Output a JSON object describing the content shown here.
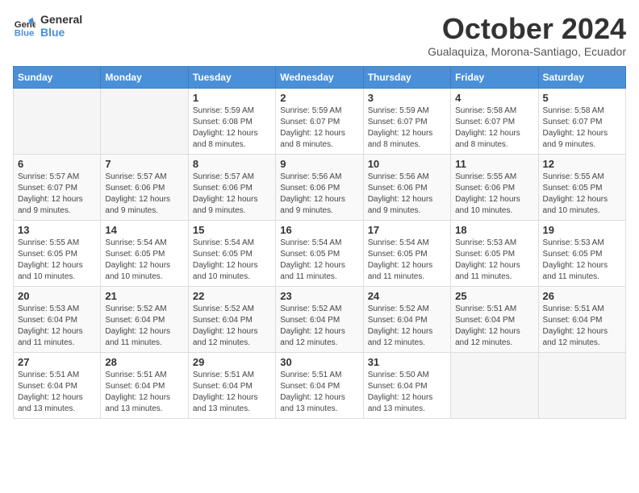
{
  "logo": {
    "line1": "General",
    "line2": "Blue"
  },
  "title": "October 2024",
  "subtitle": "Gualaquiza, Morona-Santiago, Ecuador",
  "days_of_week": [
    "Sunday",
    "Monday",
    "Tuesday",
    "Wednesday",
    "Thursday",
    "Friday",
    "Saturday"
  ],
  "weeks": [
    [
      {
        "day": "",
        "info": ""
      },
      {
        "day": "",
        "info": ""
      },
      {
        "day": "1",
        "info": "Sunrise: 5:59 AM\nSunset: 6:08 PM\nDaylight: 12 hours and 8 minutes."
      },
      {
        "day": "2",
        "info": "Sunrise: 5:59 AM\nSunset: 6:07 PM\nDaylight: 12 hours and 8 minutes."
      },
      {
        "day": "3",
        "info": "Sunrise: 5:59 AM\nSunset: 6:07 PM\nDaylight: 12 hours and 8 minutes."
      },
      {
        "day": "4",
        "info": "Sunrise: 5:58 AM\nSunset: 6:07 PM\nDaylight: 12 hours and 8 minutes."
      },
      {
        "day": "5",
        "info": "Sunrise: 5:58 AM\nSunset: 6:07 PM\nDaylight: 12 hours and 9 minutes."
      }
    ],
    [
      {
        "day": "6",
        "info": "Sunrise: 5:57 AM\nSunset: 6:07 PM\nDaylight: 12 hours and 9 minutes."
      },
      {
        "day": "7",
        "info": "Sunrise: 5:57 AM\nSunset: 6:06 PM\nDaylight: 12 hours and 9 minutes."
      },
      {
        "day": "8",
        "info": "Sunrise: 5:57 AM\nSunset: 6:06 PM\nDaylight: 12 hours and 9 minutes."
      },
      {
        "day": "9",
        "info": "Sunrise: 5:56 AM\nSunset: 6:06 PM\nDaylight: 12 hours and 9 minutes."
      },
      {
        "day": "10",
        "info": "Sunrise: 5:56 AM\nSunset: 6:06 PM\nDaylight: 12 hours and 9 minutes."
      },
      {
        "day": "11",
        "info": "Sunrise: 5:55 AM\nSunset: 6:06 PM\nDaylight: 12 hours and 10 minutes."
      },
      {
        "day": "12",
        "info": "Sunrise: 5:55 AM\nSunset: 6:05 PM\nDaylight: 12 hours and 10 minutes."
      }
    ],
    [
      {
        "day": "13",
        "info": "Sunrise: 5:55 AM\nSunset: 6:05 PM\nDaylight: 12 hours and 10 minutes."
      },
      {
        "day": "14",
        "info": "Sunrise: 5:54 AM\nSunset: 6:05 PM\nDaylight: 12 hours and 10 minutes."
      },
      {
        "day": "15",
        "info": "Sunrise: 5:54 AM\nSunset: 6:05 PM\nDaylight: 12 hours and 10 minutes."
      },
      {
        "day": "16",
        "info": "Sunrise: 5:54 AM\nSunset: 6:05 PM\nDaylight: 12 hours and 11 minutes."
      },
      {
        "day": "17",
        "info": "Sunrise: 5:54 AM\nSunset: 6:05 PM\nDaylight: 12 hours and 11 minutes."
      },
      {
        "day": "18",
        "info": "Sunrise: 5:53 AM\nSunset: 6:05 PM\nDaylight: 12 hours and 11 minutes."
      },
      {
        "day": "19",
        "info": "Sunrise: 5:53 AM\nSunset: 6:05 PM\nDaylight: 12 hours and 11 minutes."
      }
    ],
    [
      {
        "day": "20",
        "info": "Sunrise: 5:53 AM\nSunset: 6:04 PM\nDaylight: 12 hours and 11 minutes."
      },
      {
        "day": "21",
        "info": "Sunrise: 5:52 AM\nSunset: 6:04 PM\nDaylight: 12 hours and 11 minutes."
      },
      {
        "day": "22",
        "info": "Sunrise: 5:52 AM\nSunset: 6:04 PM\nDaylight: 12 hours and 12 minutes."
      },
      {
        "day": "23",
        "info": "Sunrise: 5:52 AM\nSunset: 6:04 PM\nDaylight: 12 hours and 12 minutes."
      },
      {
        "day": "24",
        "info": "Sunrise: 5:52 AM\nSunset: 6:04 PM\nDaylight: 12 hours and 12 minutes."
      },
      {
        "day": "25",
        "info": "Sunrise: 5:51 AM\nSunset: 6:04 PM\nDaylight: 12 hours and 12 minutes."
      },
      {
        "day": "26",
        "info": "Sunrise: 5:51 AM\nSunset: 6:04 PM\nDaylight: 12 hours and 12 minutes."
      }
    ],
    [
      {
        "day": "27",
        "info": "Sunrise: 5:51 AM\nSunset: 6:04 PM\nDaylight: 12 hours and 13 minutes."
      },
      {
        "day": "28",
        "info": "Sunrise: 5:51 AM\nSunset: 6:04 PM\nDaylight: 12 hours and 13 minutes."
      },
      {
        "day": "29",
        "info": "Sunrise: 5:51 AM\nSunset: 6:04 PM\nDaylight: 12 hours and 13 minutes."
      },
      {
        "day": "30",
        "info": "Sunrise: 5:51 AM\nSunset: 6:04 PM\nDaylight: 12 hours and 13 minutes."
      },
      {
        "day": "31",
        "info": "Sunrise: 5:50 AM\nSunset: 6:04 PM\nDaylight: 12 hours and 13 minutes."
      },
      {
        "day": "",
        "info": ""
      },
      {
        "day": "",
        "info": ""
      }
    ]
  ]
}
